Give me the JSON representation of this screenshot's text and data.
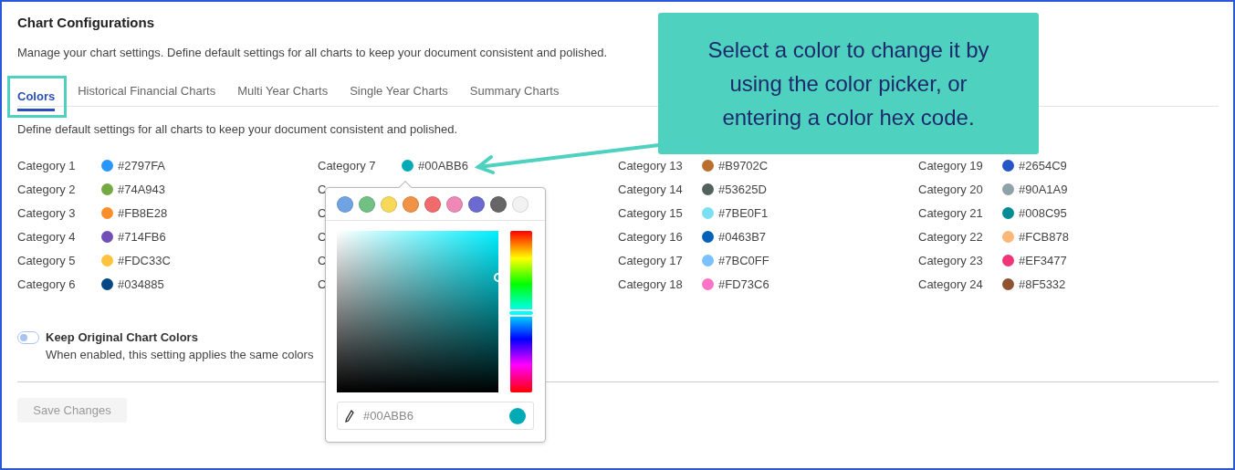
{
  "page": {
    "title": "Chart Configurations",
    "subtitle": "Manage your chart settings. Define default settings for all charts to keep your document consistent and polished."
  },
  "tabs": [
    {
      "label": "Colors",
      "selected": true,
      "highlighted": true
    },
    {
      "label": "Historical Financial Charts",
      "selected": false,
      "highlighted": false
    },
    {
      "label": "Multi Year Charts",
      "selected": false,
      "highlighted": false
    },
    {
      "label": "Single Year Charts",
      "selected": false,
      "highlighted": false
    },
    {
      "label": "Summary Charts",
      "selected": false,
      "highlighted": false
    }
  ],
  "tab_description": "Define default settings for all charts to keep your document consistent and polished.",
  "categories": [
    {
      "label": "Category 1",
      "color": "#2797fa",
      "hex": "#2797FA"
    },
    {
      "label": "Category 2",
      "color": "#74a943",
      "hex": "#74A943"
    },
    {
      "label": "Category 3",
      "color": "#fb8e28",
      "hex": "#FB8E28"
    },
    {
      "label": "Category 4",
      "color": "#714fb6",
      "hex": "#714FB6"
    },
    {
      "label": "Category 5",
      "color": "#fdc33c",
      "hex": "#FDC33C"
    },
    {
      "label": "Category 6",
      "color": "#034885",
      "hex": "#034885"
    },
    {
      "label": "Category 7",
      "color": "#00abb6",
      "hex": "#00ABB6"
    },
    {
      "label": "C"
    },
    {
      "label": "C"
    },
    {
      "label": "C"
    },
    {
      "label": "C"
    },
    {
      "label": "C"
    },
    {
      "label": "Category 13",
      "color": "#b9702c",
      "hex": "#B9702C"
    },
    {
      "label": "Category 14",
      "color": "#53625d",
      "hex": "#53625D"
    },
    {
      "label": "Category 15",
      "color": "#7be0f1",
      "hex": "#7BE0F1"
    },
    {
      "label": "Category 16",
      "color": "#0463b7",
      "hex": "#0463B7"
    },
    {
      "label": "Category 17",
      "color": "#7bc0ff",
      "hex": "#7BC0FF"
    },
    {
      "label": "Category 18",
      "color": "#fd73c6",
      "hex": "#FD73C6"
    },
    {
      "label": "Category 19",
      "color": "#2654c9",
      "hex": "#2654C9"
    },
    {
      "label": "Category 20",
      "color": "#90a1a9",
      "hex": "#90A1A9"
    },
    {
      "label": "Category 21",
      "color": "#008c95",
      "hex": "#008C95"
    },
    {
      "label": "Category 22",
      "color": "#fcb878",
      "hex": "#FCB878"
    },
    {
      "label": "Category 23",
      "color": "#ef3477",
      "hex": "#EF3477"
    },
    {
      "label": "Category 24",
      "color": "#8f5332",
      "hex": "#8F5332"
    }
  ],
  "toggle": {
    "label": "Keep Original Chart Colors",
    "description": "When enabled, this setting applies the same colors",
    "on": false
  },
  "save_button": {
    "label": "Save Changes",
    "disabled": true
  },
  "color_picker": {
    "presets": [
      {
        "color": "#6fa3e3"
      },
      {
        "color": "#72c083"
      },
      {
        "color": "#f7d95a"
      },
      {
        "color": "#f09346"
      },
      {
        "color": "#f06b6b"
      },
      {
        "color": "#ee88b5"
      },
      {
        "color": "#6c6ad0"
      },
      {
        "color": "#666666"
      },
      {
        "color": "#f2f2f2"
      }
    ],
    "value": "#00ABB6"
  },
  "callout": {
    "text": "Select a color to change it by using the color picker, or entering a color hex code."
  }
}
